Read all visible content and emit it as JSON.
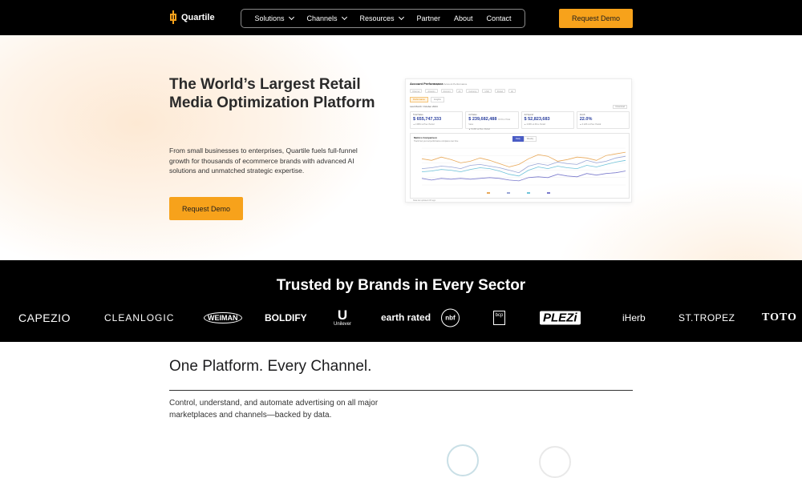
{
  "nav": {
    "brand": "Quartile",
    "menu": [
      {
        "label": "Solutions",
        "dropdown": true
      },
      {
        "label": "Channels",
        "dropdown": true
      },
      {
        "label": "Resources",
        "dropdown": true
      },
      {
        "label": "Partner",
        "dropdown": false
      },
      {
        "label": "About",
        "dropdown": false
      },
      {
        "label": "Contact",
        "dropdown": false
      }
    ],
    "cta": "Request Demo"
  },
  "hero": {
    "title": "The World’s Largest Retail Media Optimization Platform",
    "subtitle": "From small businesses to enterprises, Quartile fuels full-funnel growth for thousands of ecommerce brands with advanced AI solutions and unmatched strategic expertise.",
    "cta": "Request Demo"
  },
  "dashboard": {
    "title": "Account Performance",
    "breadcrumb": "Analytics › Account Performance",
    "filters": [
      "Channel",
      "Amazon",
      "Account",
      "All",
      "Currency",
      "USD",
      "Period",
      "All"
    ],
    "tabs": [
      "Performance",
      "Insights"
    ],
    "period_label": "Last Month: October 2024",
    "download": "Download",
    "kpis": [
      {
        "label": "Total Sales",
        "value": "$ 655,747,333",
        "note": "",
        "delta": "▲ 2.98% vs Prev. Period"
      },
      {
        "label": "Ad Sales",
        "value": "$ 239,682,488",
        "note": "36.6% of Total Sales",
        "delta": "▲ 5.13% vs Prev. Period"
      },
      {
        "label": "Ad Spend",
        "value": "$ 52,823,683",
        "note": "",
        "delta": "▲ 4.63% vs Prev. Period"
      },
      {
        "label": "ACoS",
        "value": "22.0%",
        "note": "",
        "delta": "▲ 0.12% vs Prev. Period"
      }
    ],
    "chart_title": "Metrics Comparison",
    "chart_sub": "Track how your ad performance compares over time",
    "toggle": [
      "Daily",
      "Weekly"
    ],
    "chart_data": {
      "type": "line",
      "series": [
        {
          "color": "#e8a95a",
          "values": [
            52,
            50,
            54,
            51,
            47,
            49,
            53,
            50,
            46,
            42,
            45,
            52,
            57,
            55,
            49,
            51,
            54,
            53,
            50,
            56,
            58,
            60
          ]
        },
        {
          "color": "#9aa6d6",
          "values": [
            40,
            41,
            43,
            42,
            40,
            44,
            45,
            43,
            41,
            38,
            35,
            43,
            46,
            44,
            48,
            46,
            45,
            50,
            47,
            49,
            53,
            55
          ]
        },
        {
          "color": "#6fc3d9",
          "values": [
            36,
            37,
            39,
            38,
            36,
            39,
            41,
            40,
            37,
            33,
            31,
            38,
            42,
            40,
            43,
            41,
            40,
            44,
            42,
            45,
            48,
            50
          ]
        },
        {
          "color": "#7a7acc",
          "values": [
            28,
            26,
            28,
            27,
            28,
            27,
            28,
            29,
            28,
            26,
            25,
            29,
            30,
            29,
            33,
            31,
            30,
            34,
            32,
            34,
            35,
            37
          ]
        }
      ]
    },
    "footer": "Data last updated 24h ago"
  },
  "brands": {
    "heading": "Trusted by Brands in Every Sector",
    "logos": [
      "CAPEZIO",
      "CLEANLOGIC",
      "WEIMAN",
      "BOLDIFY",
      "Unilever",
      "earth rated",
      "nbf",
      "bcp",
      "PLEZi",
      "iHerb",
      "ST.TROPEZ",
      "TOTO"
    ]
  },
  "channels": {
    "heading": "One Platform. Every Channel.",
    "text": "Control, understand, and automate advertising on all major marketplaces and channels—backed by data."
  }
}
